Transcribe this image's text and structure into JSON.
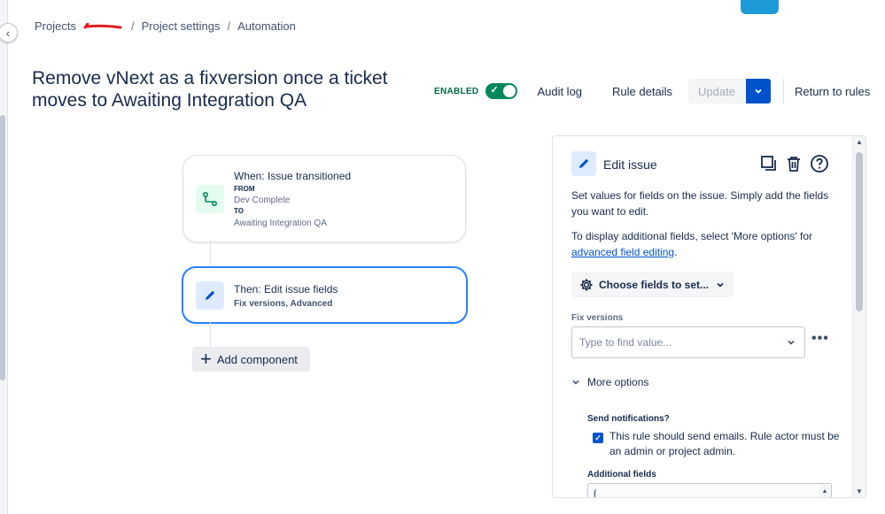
{
  "breadcrumb": {
    "projects": "Projects",
    "project_settings": "Project settings",
    "automation": "Automation",
    "separator": "/"
  },
  "rule": {
    "title": "Remove vNext as a fixversion once a ticket moves to Awaiting Integration QA"
  },
  "header": {
    "enabled_label": "ENABLED",
    "toggle_on": true,
    "audit_log": "Audit log",
    "rule_details": "Rule details",
    "update": "Update",
    "return_to_rules": "Return to rules"
  },
  "canvas": {
    "trigger": {
      "title": "When: Issue transitioned",
      "from_label": "FROM",
      "from_value": "Dev Complete",
      "to_label": "TO",
      "to_value": "Awaiting Integration QA",
      "icon": "transition-icon"
    },
    "action": {
      "title": "Then: Edit issue fields",
      "subtitle": "Fix versions, Advanced",
      "icon": "pencil-icon"
    },
    "add_component": "Add component"
  },
  "panel": {
    "title": "Edit issue",
    "description_1": "Set values for fields on the issue. Simply add the fields you want to edit.",
    "description_2_prefix": "To display additional fields, select 'More options' for",
    "description_2_link": "advanced field editing",
    "description_2_suffix": ".",
    "choose_fields": "Choose fields to set...",
    "fix_versions_label": "Fix versions",
    "fix_versions_placeholder": "Type to find value...",
    "more_options": "More options",
    "send_notifications_label": "Send notifications?",
    "send_notifications_checked": true,
    "send_notifications_text": "This rule should send emails. Rule actor must be an admin or project admin.",
    "additional_fields_label": "Additional fields",
    "additional_fields_value": "{"
  },
  "colors": {
    "primary": "#0052cc",
    "enabled_green": "#00875a",
    "selected_border": "#2684ff"
  }
}
